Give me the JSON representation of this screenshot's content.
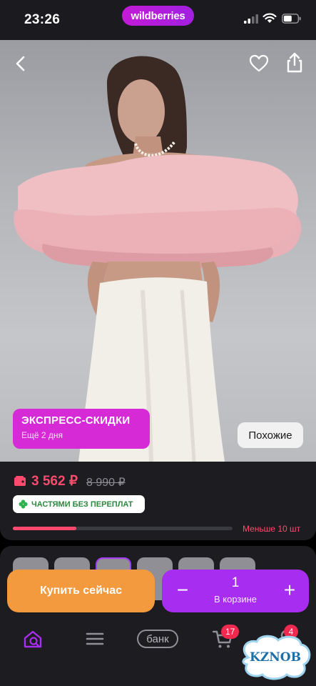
{
  "status_bar": {
    "time": "23:26",
    "brand": "wildberries",
    "icons": [
      "signal-icon",
      "wifi-icon",
      "battery-icon"
    ]
  },
  "hero": {
    "promo": {
      "title": "ЭКСПРЕСС-СКИДКИ",
      "subtitle": "Ещё 2 дня"
    },
    "similar_label": "Похожие",
    "icons": [
      "back-icon",
      "heart-icon",
      "share-icon"
    ]
  },
  "price": {
    "current": "3 562 ₽",
    "old": "8 990 ₽",
    "installment_label": "ЧАСТЯМИ БЕЗ ПЕРЕПЛАТ",
    "stock_text": "Меньше 10 шт",
    "stock_level": 0.29
  },
  "actions": {
    "buy_now": "Купить сейчас",
    "quantity": "1",
    "in_cart_label": "В корзине",
    "minus": "−",
    "plus": "+"
  },
  "nav": {
    "bank_label": "банк",
    "cart_count": "17",
    "profile_count": "4"
  },
  "watermark": "KZNOB",
  "colors": {
    "accent": "#a72ef0",
    "buy_now": "#f39a3f",
    "price": "#ff4a6e",
    "promo": "#d52ad6"
  }
}
